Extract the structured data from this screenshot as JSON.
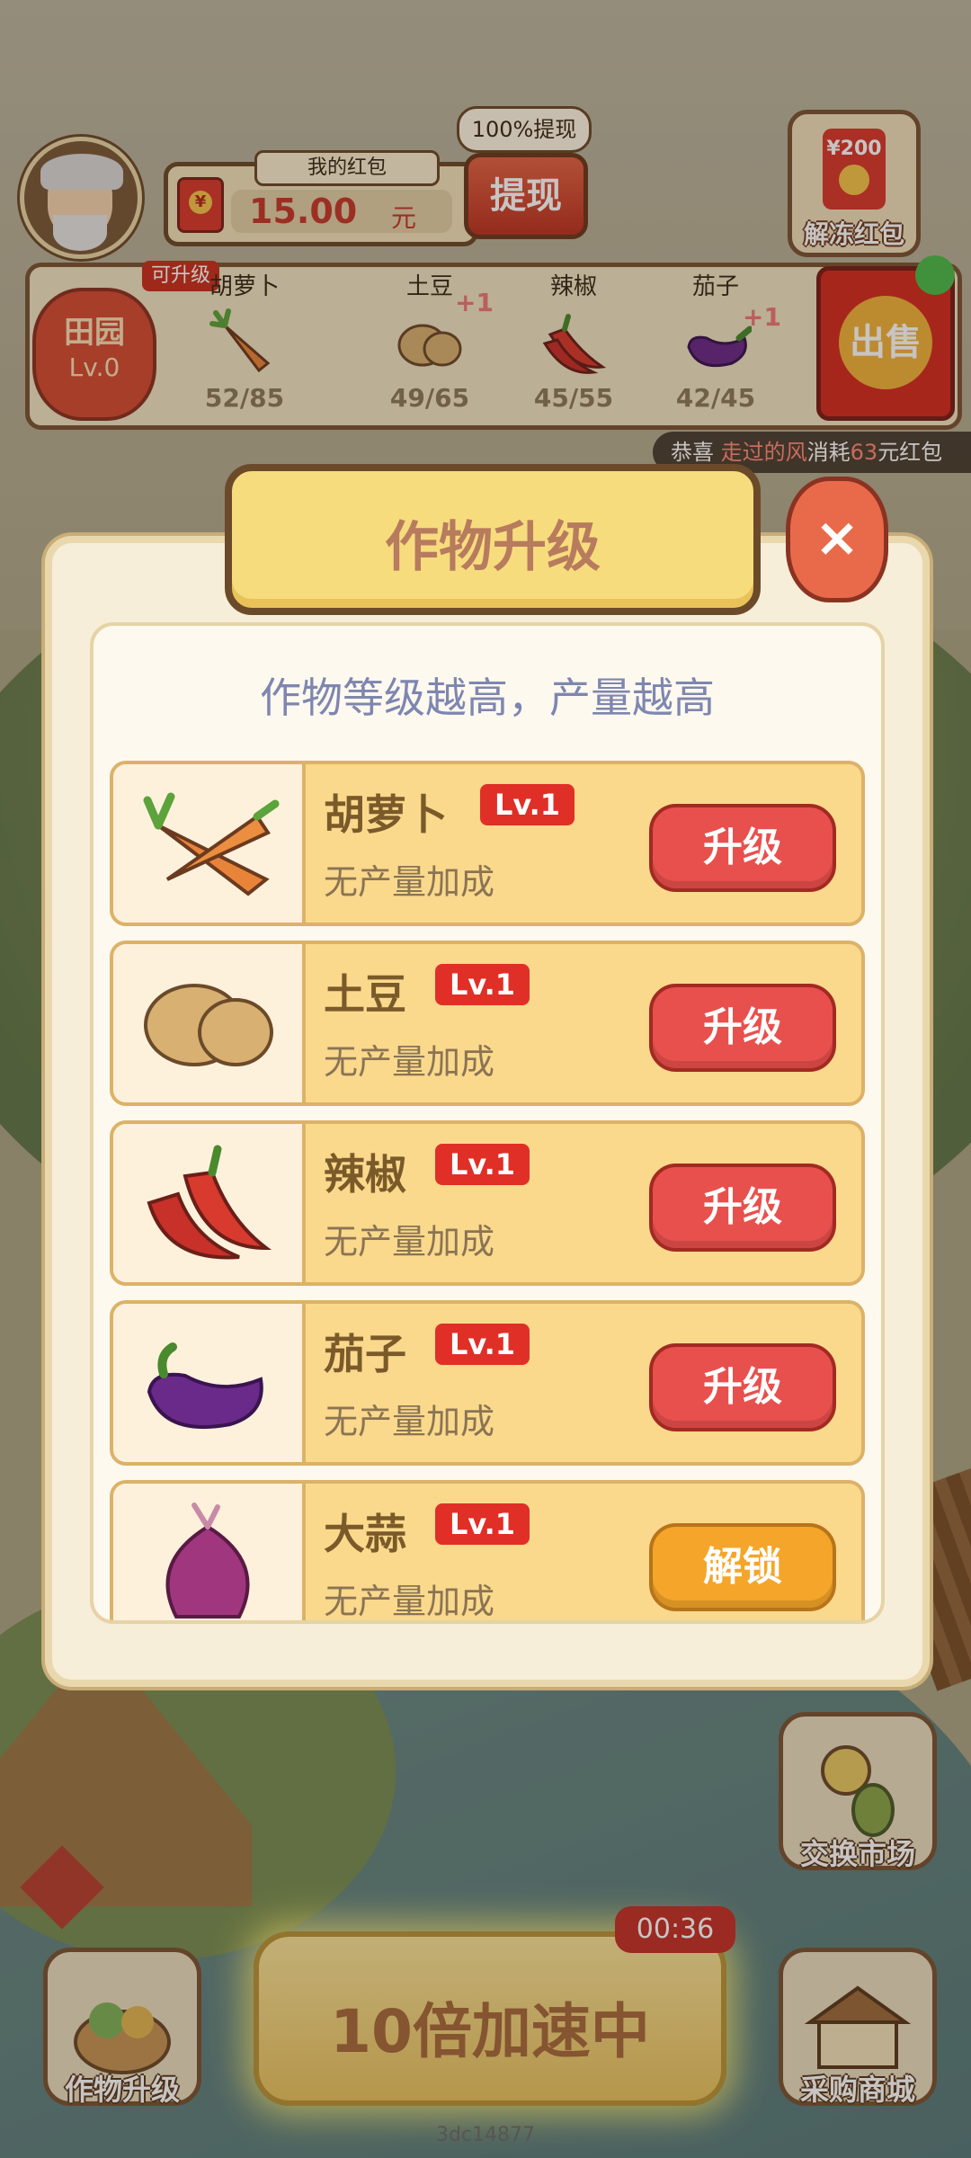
{
  "hud": {
    "wallet_title": "我的红包",
    "wallet_amount": "15.00",
    "wallet_unit": "元",
    "withdraw_label": "提现",
    "withdraw_tag": "100%提现",
    "unfreeze_amount": "¥200",
    "unfreeze_label": "解冻红包"
  },
  "field": {
    "name": "田园",
    "level": "Lv.0",
    "upgradable_tag": "可升级"
  },
  "crops_bar": [
    {
      "name": "胡萝卜",
      "count": "52/85",
      "icon": "carrot-icon"
    },
    {
      "name": "土豆",
      "count": "49/65",
      "icon": "potato-icon",
      "plus": "+1"
    },
    {
      "name": "辣椒",
      "count": "45/55",
      "icon": "chili-icon"
    },
    {
      "name": "茄子",
      "count": "42/45",
      "icon": "eggplant-icon",
      "plus": "+1"
    }
  ],
  "sell_label": "出售",
  "ticker": {
    "prefix": "恭喜",
    "user": "走过的风",
    "mid": "消耗",
    "amount": "63",
    "suffix": "元红包"
  },
  "modal": {
    "title": "作物升级",
    "close": "×",
    "subtitle": "作物等级越高，产量越高",
    "rows": [
      {
        "name": "胡萝卜",
        "level": "Lv.1",
        "bonus": "无产量加成",
        "button": "升级",
        "icon": "carrot-icon"
      },
      {
        "name": "土豆",
        "level": "Lv.1",
        "bonus": "无产量加成",
        "button": "升级",
        "icon": "potato-icon"
      },
      {
        "name": "辣椒",
        "level": "Lv.1",
        "bonus": "无产量加成",
        "button": "升级",
        "icon": "chili-icon"
      },
      {
        "name": "茄子",
        "level": "Lv.1",
        "bonus": "无产量加成",
        "button": "升级",
        "icon": "eggplant-icon"
      },
      {
        "name": "大蒜",
        "level": "Lv.1",
        "bonus": "无产量加成",
        "button": "解锁",
        "icon": "garlic-icon"
      }
    ]
  },
  "bottom": {
    "crop_upgrade_label": "作物升级",
    "speed_label": "10倍加速中",
    "timer": "00:36",
    "exchange_label": "交换市场",
    "shop_label": "采购商城",
    "watermark": "3dc14877"
  },
  "colors": {
    "accent_red": "#e02f26",
    "upgrade_button": "#e8504d",
    "unlock_button": "#f4a52a",
    "row_background": "#fad98d"
  }
}
